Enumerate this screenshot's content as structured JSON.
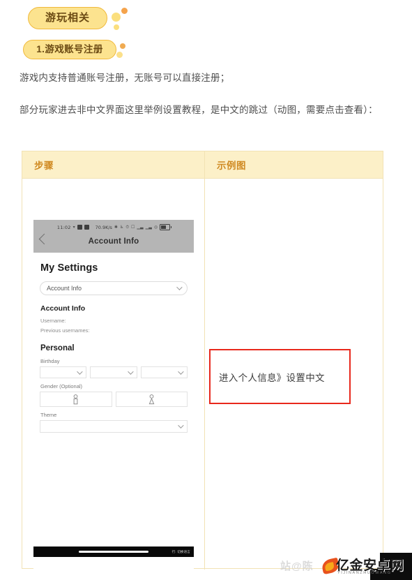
{
  "badges": {
    "primary": "游玩相关",
    "secondary": "1.游戏账号注册"
  },
  "paragraphs": {
    "p1": "游戏内支持普通账号注册，无账号可以直接注册；",
    "p2": "部分玩家进去非中文界面这里举例设置教程，是中文的跳过（动图，需要点击查看）："
  },
  "table": {
    "headers": [
      "步骤",
      "示例图"
    ]
  },
  "phone": {
    "status_bar": {
      "time": "11:02",
      "network_speed": "70.9K/s"
    },
    "nav_title": "Account Info",
    "heading": "My Settings",
    "category_select": "Account Info",
    "section_account": "Account Info",
    "username_label": "Username:",
    "previous_usernames_label": "Previous usernames:",
    "section_personal": "Personal",
    "birthday_label": "Birthday",
    "gender_label": "Gender (Optional)",
    "theme_label": "Theme",
    "home_bar_text": "行: 切换语言"
  },
  "callout": {
    "text": "进入个人信息》设置中文"
  },
  "watermark": {
    "ghost": "站@陈",
    "main": "亿金安卓网",
    "sub": "YIJINANZHUOWANG"
  },
  "colors": {
    "badge_bg": "#fce38f",
    "badge_border": "#f0b93c",
    "table_header_bg": "#fcf0c8",
    "table_header_text": "#d08a22",
    "table_border": "#f2e2b4",
    "callout_border": "#e8281c"
  }
}
